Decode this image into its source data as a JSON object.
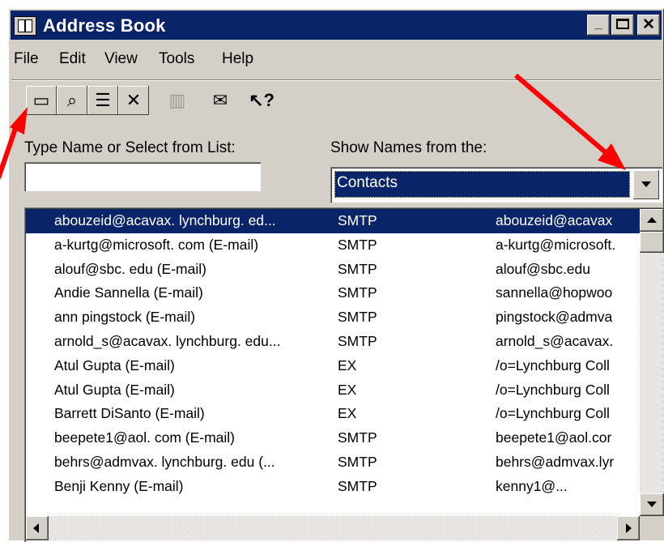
{
  "window": {
    "title": "Address Book"
  },
  "menu": [
    "File",
    "Edit",
    "View",
    "Tools",
    "Help"
  ],
  "toolbar": [
    {
      "icon": "new-entry-icon",
      "glyph": "▭"
    },
    {
      "icon": "find-icon",
      "glyph": "⌕"
    },
    {
      "icon": "properties-icon",
      "glyph": "☰"
    },
    {
      "icon": "delete-icon",
      "glyph": "✕"
    },
    {
      "icon": "personal-address-book-icon",
      "glyph": "▥"
    },
    {
      "icon": "new-message-icon",
      "glyph": "✉"
    },
    {
      "icon": "help-icon",
      "glyph": "↖?"
    }
  ],
  "form": {
    "type_name_label": "Type Name or Select from List:",
    "type_name_value": "",
    "show_names_label": "Show Names from the:",
    "show_names_value": "Contacts"
  },
  "list": {
    "rows": [
      {
        "name": "abouzeid@acavax. lynchburg. ed...",
        "type": "SMTP",
        "address": "abouzeid@acavax"
      },
      {
        "name": "a-kurtg@microsoft. com (E-mail)",
        "type": "SMTP",
        "address": "a-kurtg@microsoft."
      },
      {
        "name": "alouf@sbc. edu (E-mail)",
        "type": "SMTP",
        "address": "alouf@sbc.edu"
      },
      {
        "name": "Andie Sannella (E-mail)",
        "type": "SMTP",
        "address": "sannella@hopwoo"
      },
      {
        "name": "ann pingstock (E-mail)",
        "type": "SMTP",
        "address": "pingstock@admva"
      },
      {
        "name": "arnold_s@acavax. lynchburg. edu...",
        "type": "SMTP",
        "address": "arnold_s@acavax."
      },
      {
        "name": "Atul Gupta (E-mail)",
        "type": "EX",
        "address": "/o=Lynchburg Coll"
      },
      {
        "name": "Atul Gupta (E-mail)",
        "type": "EX",
        "address": "/o=Lynchburg Coll"
      },
      {
        "name": "Barrett DiSanto (E-mail)",
        "type": "EX",
        "address": "/o=Lynchburg Coll"
      },
      {
        "name": "beepete1@aol. com (E-mail)",
        "type": "SMTP",
        "address": "beepete1@aol.cor"
      },
      {
        "name": "behrs@admvax. lynchburg. edu (...",
        "type": "SMTP",
        "address": "behrs@admvax.lyr"
      },
      {
        "name": "Benji Kenny (E-mail)",
        "type": "SMTP",
        "address": "kenny1@..."
      }
    ],
    "selected_index": 0
  },
  "colors": {
    "selection": "#0a246a",
    "face": "#d4d0c8",
    "annotation_arrow": "#ff0000"
  }
}
